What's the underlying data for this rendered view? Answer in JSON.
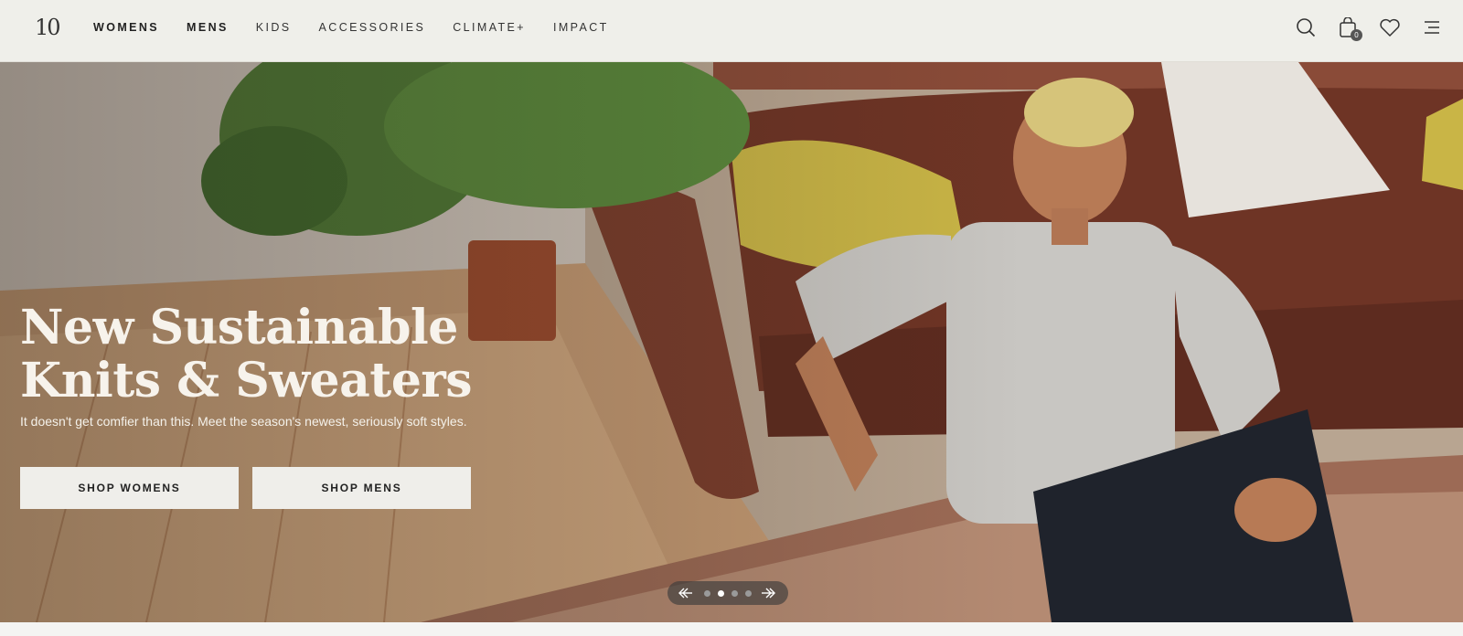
{
  "header": {
    "logo": {
      "text": "10",
      "icon": "tree-icon"
    },
    "nav": [
      {
        "label": "WOMENS",
        "bold": true
      },
      {
        "label": "MENS",
        "bold": true
      },
      {
        "label": "KIDS",
        "bold": false
      },
      {
        "label": "ACCESSORIES",
        "bold": false
      },
      {
        "label": "CLIMATE+",
        "bold": false
      },
      {
        "label": "IMPACT",
        "bold": false
      }
    ],
    "icons": {
      "search": "search-icon",
      "cart": "shopping-bag-icon",
      "cart_count": "0",
      "wishlist": "heart-icon",
      "menu": "hamburger-menu-icon"
    }
  },
  "hero": {
    "title_line1": "New Sustainable",
    "title_line2": "Knits & Sweaters",
    "subtitle": "It doesn't get comfier than this. Meet the season's newest, seriously soft styles.",
    "buttons": {
      "women": "SHOP WOMENS",
      "men": "SHOP MENS"
    },
    "carousel": {
      "prev_icon": "arrow-left-icon",
      "next_icon": "arrow-right-icon",
      "slides": 4,
      "active_slide": 2
    }
  },
  "colors": {
    "header_bg": "#efefea",
    "button_bg": "#efeeea",
    "hero_text": "#f7f3ec"
  }
}
